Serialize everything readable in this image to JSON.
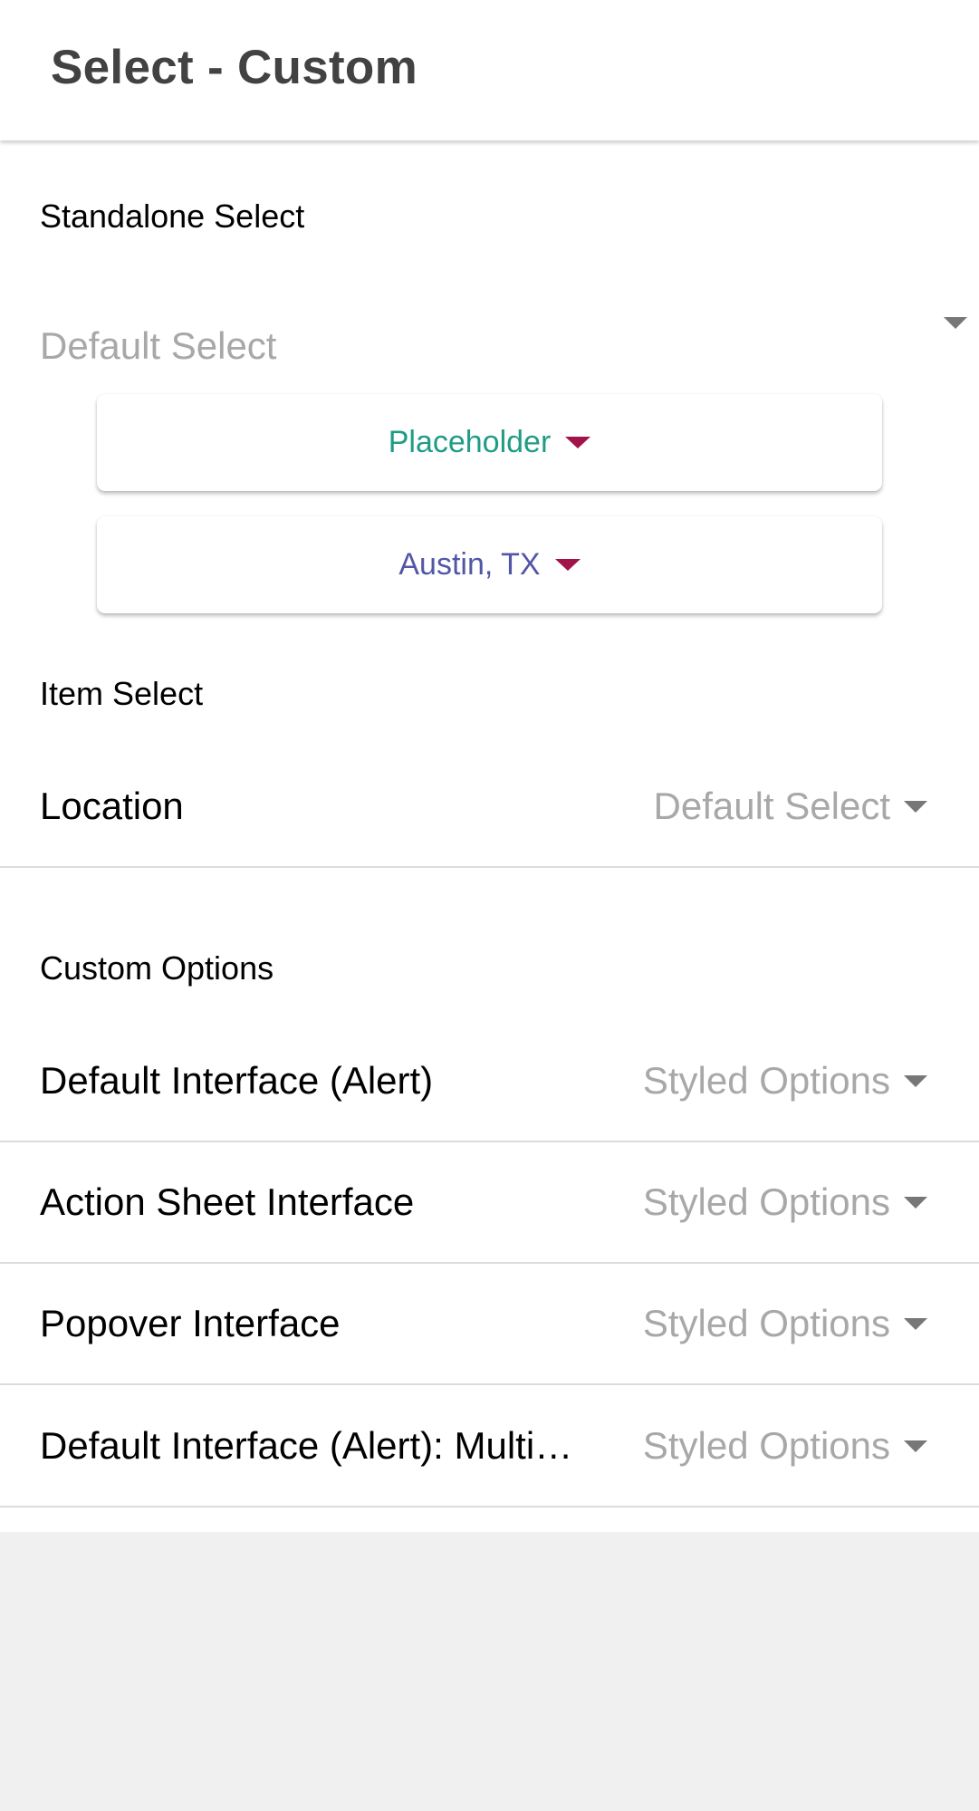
{
  "header": {
    "title": "Select - Custom"
  },
  "standalone": {
    "section_label": "Standalone Select",
    "default_select": "Default Select",
    "placeholder_button": "Placeholder",
    "location_button": "Austin, TX"
  },
  "item_select": {
    "section_label": "Item Select",
    "location": {
      "label": "Location",
      "value": "Default Select"
    }
  },
  "custom_options": {
    "section_label": "Custom Options",
    "items": [
      {
        "label": "Default Interface (Alert)",
        "value": "Styled Options"
      },
      {
        "label": "Action Sheet Interface",
        "value": "Styled Options"
      },
      {
        "label": "Popover Interface",
        "value": "Styled Options"
      },
      {
        "label": "Default Interface (Alert): Multiple Selection",
        "value": "Styled Options"
      }
    ]
  },
  "colors": {
    "placeholder_text": "#1f9c86",
    "location_text": "#5256a8",
    "caret_accent": "#a0144a",
    "muted_text": "#a8a8a8"
  },
  "icons": {
    "dropdown": "caret-down-icon"
  }
}
